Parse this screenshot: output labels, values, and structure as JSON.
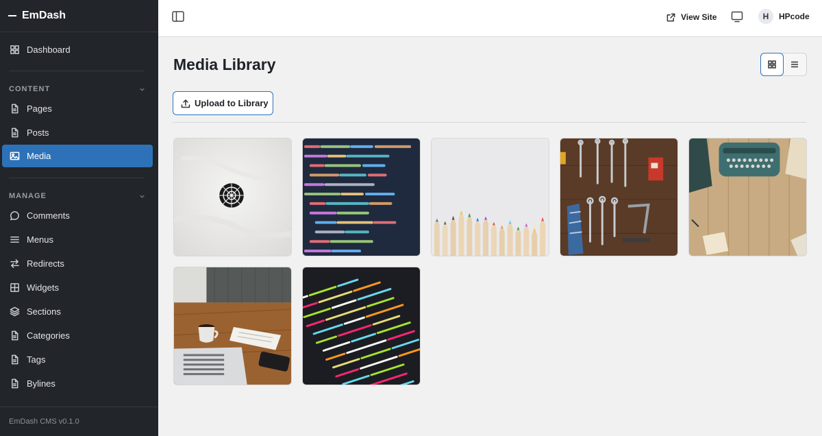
{
  "app": {
    "brand": "EmDash",
    "version": "EmDash CMS v0.1.0"
  },
  "sidebar": {
    "top_item": {
      "label": "Dashboard",
      "icon": "grid-icon"
    },
    "content_label": "CONTENT",
    "content_items": [
      {
        "label": "Pages",
        "icon": "file-icon"
      },
      {
        "label": "Posts",
        "icon": "file-icon"
      },
      {
        "label": "Media",
        "icon": "image-icon",
        "active": true
      }
    ],
    "manage_label": "MANAGE",
    "manage_items": [
      {
        "label": "Comments",
        "icon": "speech-bubble-icon"
      },
      {
        "label": "Menus",
        "icon": "menu-icon"
      },
      {
        "label": "Redirects",
        "icon": "arrows-icon"
      },
      {
        "label": "Widgets",
        "icon": "widget-grid-icon"
      },
      {
        "label": "Sections",
        "icon": "layers-icon"
      },
      {
        "label": "Categories",
        "icon": "file-icon"
      },
      {
        "label": "Tags",
        "icon": "file-icon"
      },
      {
        "label": "Bylines",
        "icon": "file-icon"
      }
    ]
  },
  "header": {
    "view_site": "View Site",
    "user": {
      "initial": "H",
      "name": "HPcode"
    }
  },
  "main": {
    "title": "Media Library",
    "upload_label": "Upload to Library",
    "view_mode": "grid",
    "media": [
      {
        "kind": "paper-mandala"
      },
      {
        "kind": "code-screen"
      },
      {
        "kind": "colored-pencils"
      },
      {
        "kind": "tool-wall"
      },
      {
        "kind": "typewriter"
      },
      {
        "kind": "desk-laptop-coffee"
      },
      {
        "kind": "code-screen-dark"
      }
    ]
  },
  "colors": {
    "sidebar_bg": "#222529",
    "accent": "#2d72b8",
    "page_bg": "#f1f1f1"
  }
}
